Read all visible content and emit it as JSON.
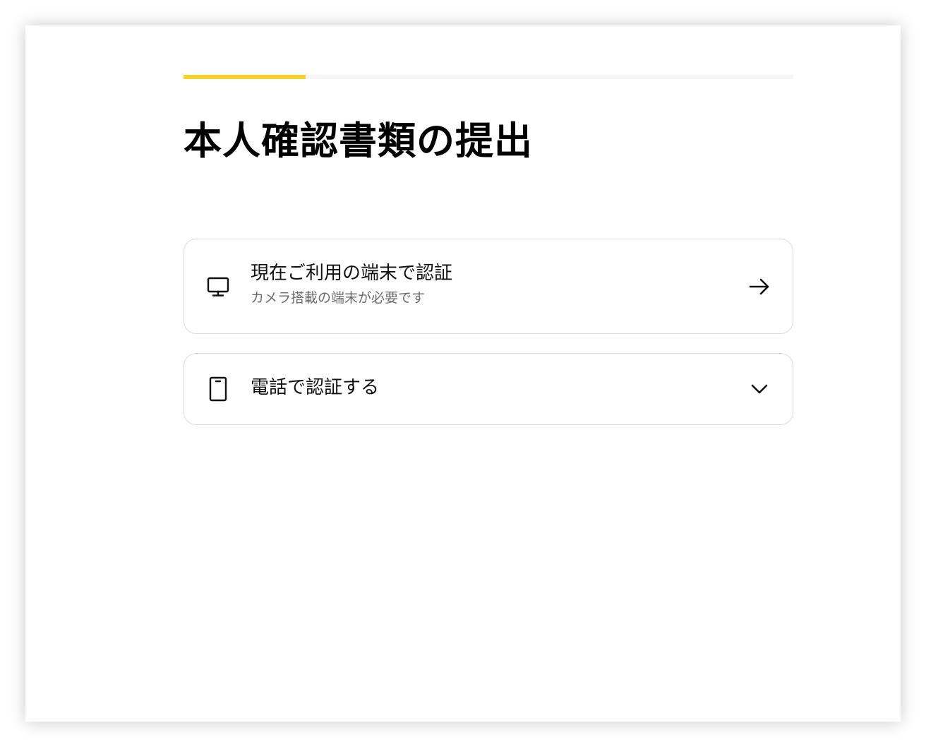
{
  "progress": {
    "value": 0.2
  },
  "page": {
    "title": "本人確認書類の提出"
  },
  "options": [
    {
      "label": "現在ご利用の端末で認証",
      "sublabel": "カメラ搭載の端末が必要です",
      "icon": "monitor-icon",
      "action_icon": "arrow-right-icon"
    },
    {
      "label": "電話で認証する",
      "icon": "phone-icon",
      "action_icon": "chevron-down-icon"
    }
  ],
  "colors": {
    "accent": "#f5d22e",
    "border": "#dcdcdc",
    "text": "#111111",
    "subtext": "#6b6b6b"
  }
}
